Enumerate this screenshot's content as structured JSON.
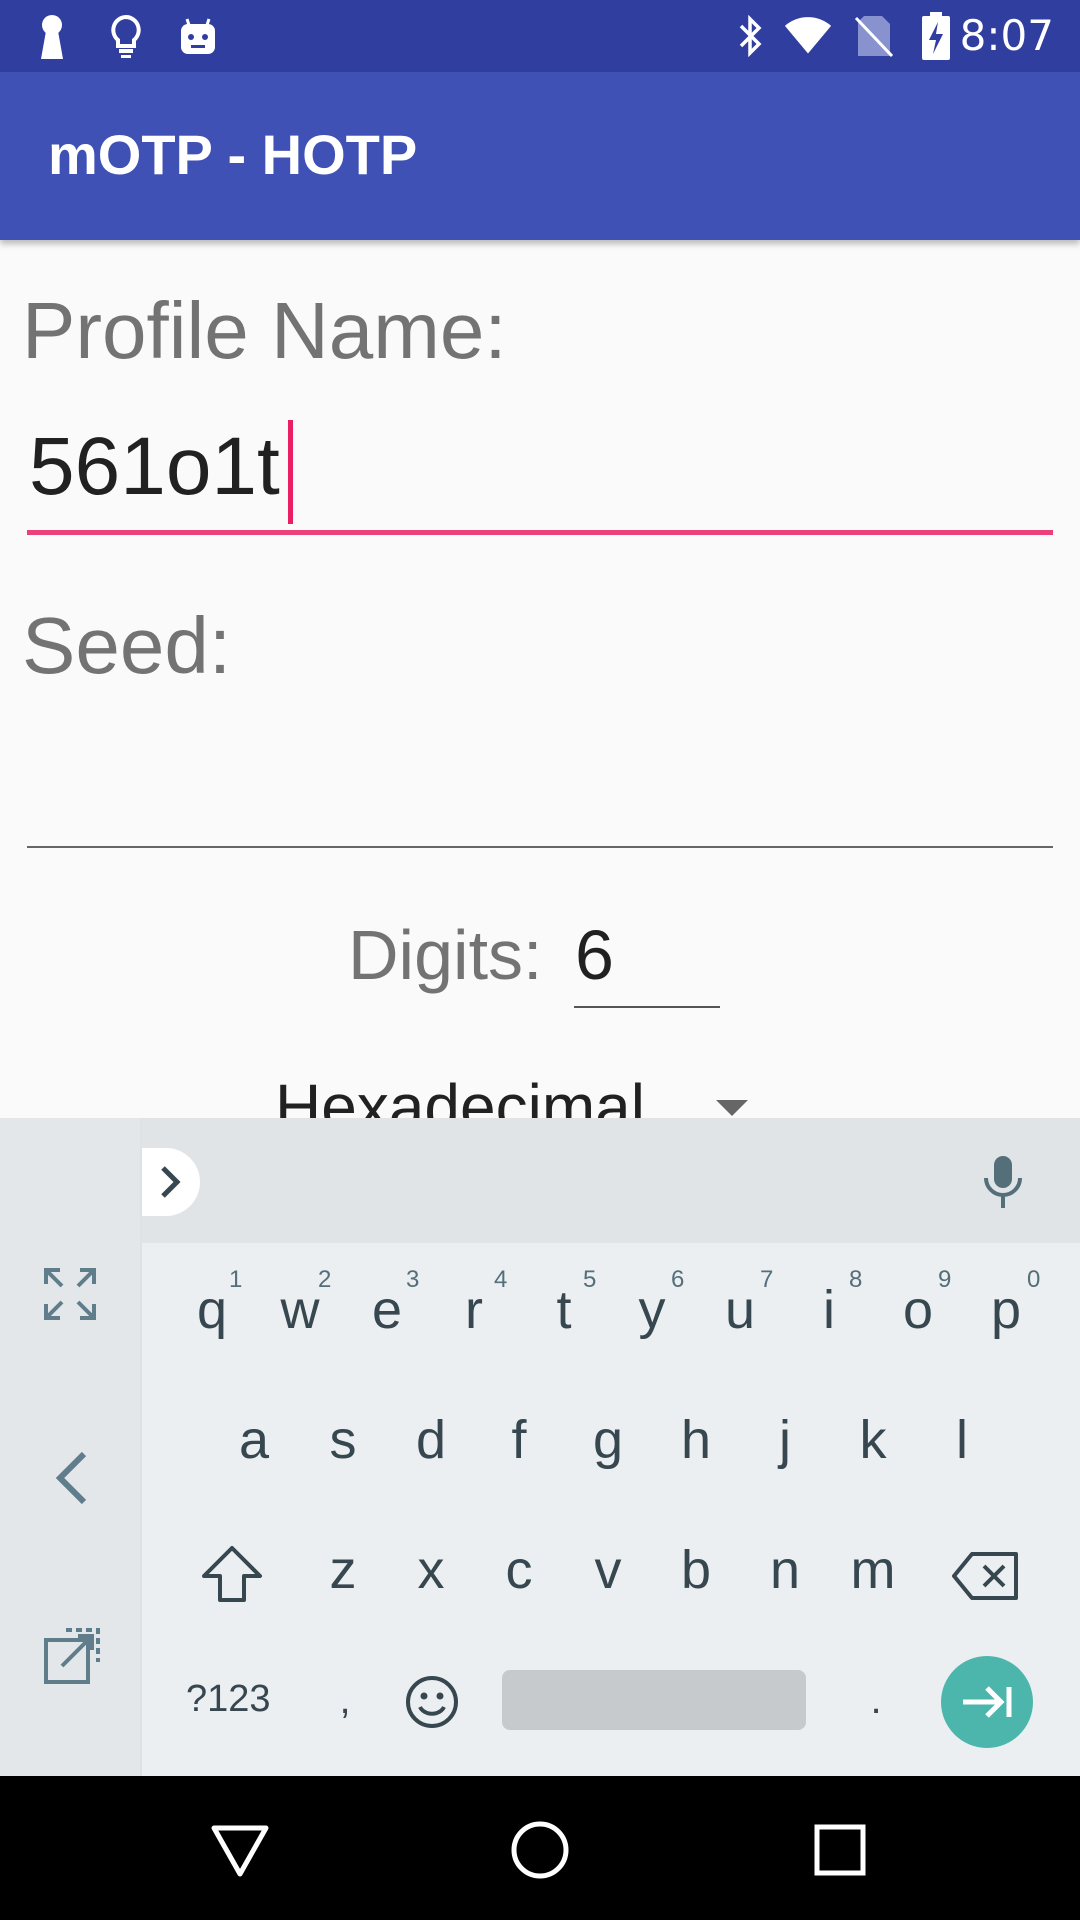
{
  "status_bar": {
    "time": "8:07",
    "left_icons": [
      "keyhole-icon",
      "lightbulb-icon",
      "android-icon"
    ],
    "right_icons": [
      "bluetooth-icon",
      "wifi-icon",
      "no-sim-icon",
      "battery-charging-icon"
    ]
  },
  "app_bar": {
    "title": "mOTP - HOTP"
  },
  "form": {
    "profile_name_label": "Profile Name:",
    "profile_name_value": "561o1t",
    "seed_label": "Seed:",
    "seed_value": "",
    "digits_label": "Digits:",
    "digits_value": "6",
    "format_value": "Hexadecimal"
  },
  "keyboard": {
    "row1": [
      {
        "key": "q",
        "hint": "1"
      },
      {
        "key": "w",
        "hint": "2"
      },
      {
        "key": "e",
        "hint": "3"
      },
      {
        "key": "r",
        "hint": "4"
      },
      {
        "key": "t",
        "hint": "5"
      },
      {
        "key": "y",
        "hint": "6"
      },
      {
        "key": "u",
        "hint": "7"
      },
      {
        "key": "i",
        "hint": "8"
      },
      {
        "key": "o",
        "hint": "9"
      },
      {
        "key": "p",
        "hint": "0"
      }
    ],
    "row2": [
      "a",
      "s",
      "d",
      "f",
      "g",
      "h",
      "j",
      "k",
      "l"
    ],
    "row3": [
      "z",
      "x",
      "c",
      "v",
      "b",
      "n",
      "m"
    ],
    "symbols_label": "?123",
    "comma": ",",
    "period": "."
  },
  "colors": {
    "status_bar": "#303f9f",
    "app_bar": "#3f51b5",
    "accent": "#e91e63",
    "enter_key": "#4db6ac"
  }
}
